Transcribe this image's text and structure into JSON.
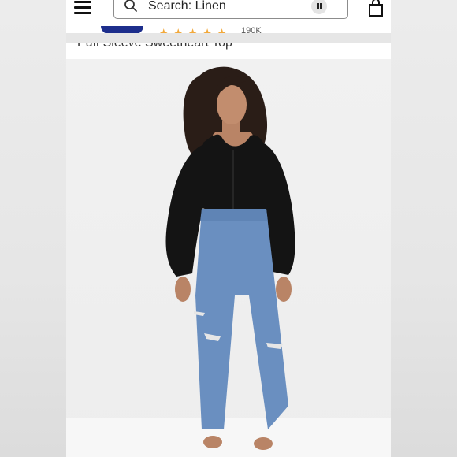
{
  "header": {
    "search_placeholder": "Search: Linen"
  },
  "product": {
    "title": "Puff Sleeve Sweetheart Top",
    "rating_stars": 5,
    "rating_count": "190K",
    "image_alt": "Model wearing black puff sleeve sweetheart top with light wash ripped jeans"
  },
  "icons": {
    "menu": "hamburger-menu-icon",
    "search": "search-icon",
    "pause": "pause-icon",
    "bag": "shopping-bag-icon",
    "star": "star-icon"
  },
  "colors": {
    "star": "#f2a93b",
    "brand_pill": "#1d2e8c",
    "top": "#141414",
    "denim": "#6a8fc0"
  }
}
